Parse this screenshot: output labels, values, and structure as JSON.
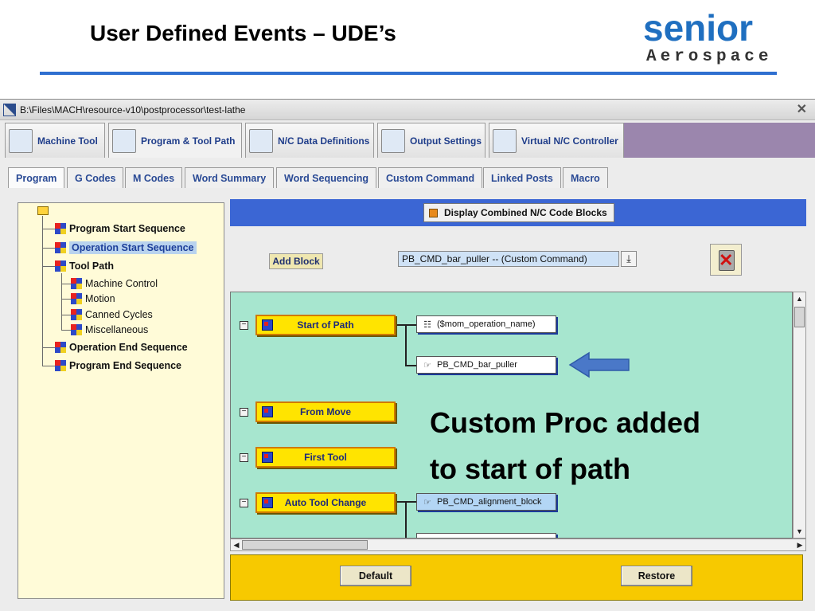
{
  "slide": {
    "title": "User Defined Events – UDE’s",
    "logo_word": "senior",
    "logo_sub": "Aerospace"
  },
  "window": {
    "path": "B:\\Files\\MACH\\resource-v10\\postprocessor\\test-lathe",
    "close_glyph": "✕"
  },
  "main_tabs": [
    {
      "label": "Machine Tool",
      "icon": "machine-tool-icon"
    },
    {
      "label": "Program & Tool Path",
      "icon": "program-path-icon"
    },
    {
      "label": "N/C Data Definitions",
      "icon": "data-definitions-icon"
    },
    {
      "label": "Output Settings",
      "icon": "printer-icon"
    },
    {
      "label": "Virtual N/C Controller",
      "icon": "controller-icon"
    }
  ],
  "sub_tabs": [
    "Program",
    "G Codes",
    "M Codes",
    "Word Summary",
    "Word Sequencing",
    "Custom Command",
    "Linked Posts",
    "Macro"
  ],
  "tree": {
    "items": [
      {
        "label": "Program Start Sequence"
      },
      {
        "label": "Operation Start Sequence"
      },
      {
        "label": "Tool Path"
      },
      {
        "label": "Machine Control"
      },
      {
        "label": "Motion"
      },
      {
        "label": "Canned Cycles"
      },
      {
        "label": "Miscellaneous"
      },
      {
        "label": "Operation End Sequence"
      },
      {
        "label": "Program End Sequence"
      }
    ]
  },
  "toolbar": {
    "display_combined": "Display Combined N/C Code Blocks",
    "add_block": "Add Block",
    "combo_value": "PB_CMD_bar_puller -- (Custom Command)",
    "combo_arrow": "⤓"
  },
  "events": [
    {
      "label": "Start of Path",
      "collapse": "−"
    },
    {
      "label": "From Move",
      "collapse": "−"
    },
    {
      "label": "First Tool",
      "collapse": "−"
    },
    {
      "label": "Auto Tool Change",
      "collapse": "−"
    }
  ],
  "blocks": [
    {
      "label": "($mom_operation_name)",
      "icon": "☷"
    },
    {
      "label": "PB_CMD_bar_puller",
      "icon": "☞"
    },
    {
      "label": "PB_CMD_alignment_block",
      "icon": "☞"
    }
  ],
  "annotation": {
    "line1": "Custom Proc added",
    "line2": "to start of path",
    "arrow_color": "#4a78c8"
  },
  "footer": {
    "default": "Default",
    "restore": "Restore"
  },
  "scroll": {
    "up": "▲",
    "down": "▼",
    "left": "◀",
    "right": "▶"
  }
}
